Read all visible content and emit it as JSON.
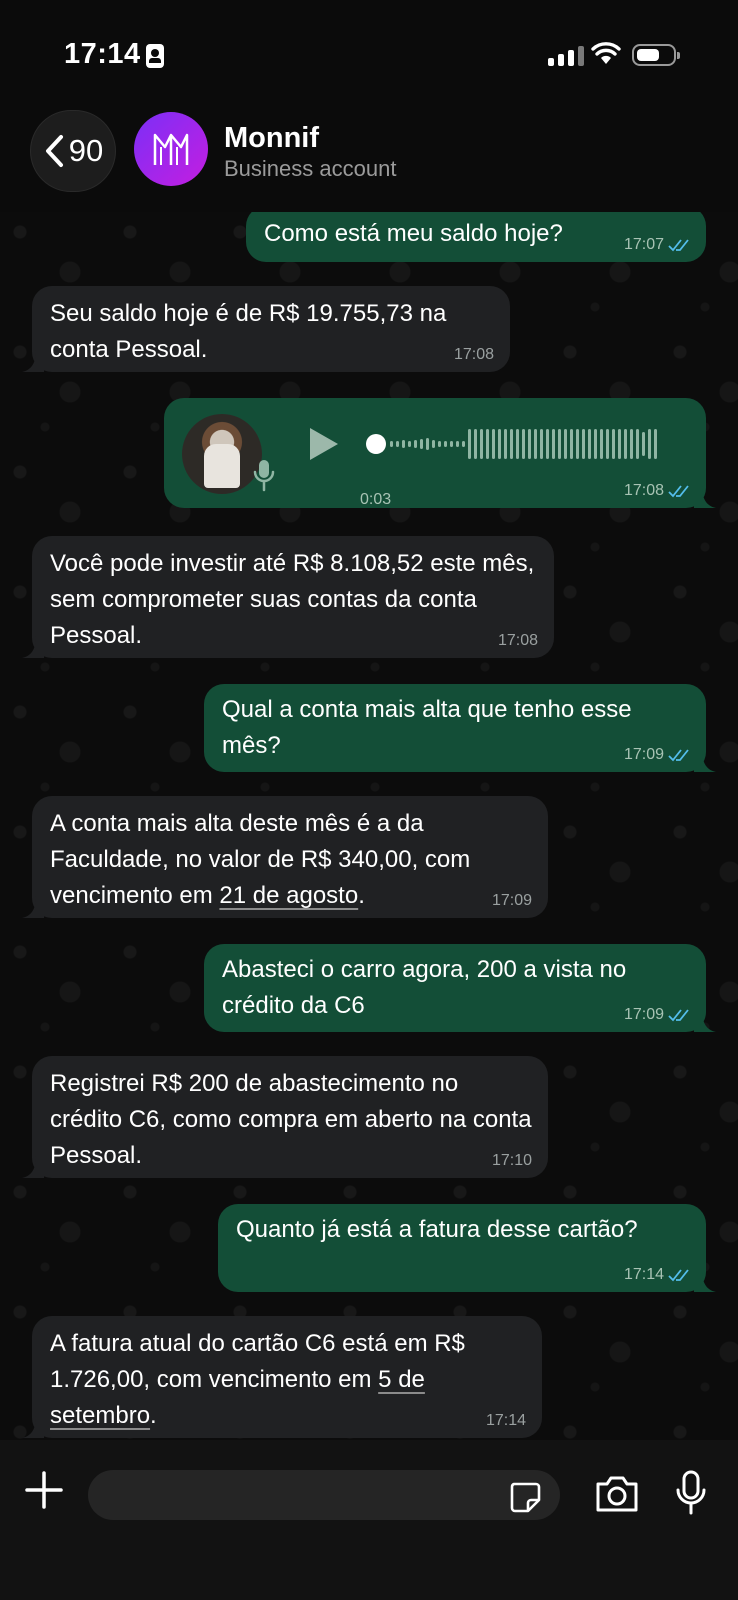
{
  "status_bar": {
    "time": "17:14"
  },
  "header": {
    "back_count": "90",
    "contact_name": "Monnif",
    "contact_subtitle": "Business account"
  },
  "messages": [
    {
      "dir": "out",
      "text": "Como está meu saldo hoje?",
      "time": "17:07",
      "read": true
    },
    {
      "dir": "in",
      "text": "Seu saldo hoje é de R$ 19.755,73 na conta Pessoal.",
      "time": "17:08"
    },
    {
      "dir": "out",
      "type": "voice",
      "duration": "0:03",
      "time": "17:08",
      "read": true
    },
    {
      "dir": "in",
      "text": "Você pode investir até R$ 8.108,52 este mês, sem comprometer suas contas da conta Pessoal.",
      "time": "17:08"
    },
    {
      "dir": "out",
      "text": "Qual a conta mais alta que tenho esse mês?",
      "time": "17:09",
      "read": true
    },
    {
      "dir": "in",
      "text_before": "A conta mais alta deste mês é a da Faculdade, no valor de R$ 340,00, com vencimento em ",
      "link": "21 de agosto",
      "text_after": ".",
      "time": "17:09"
    },
    {
      "dir": "out",
      "text": "Abasteci o carro agora, 200 a vista no crédito da C6",
      "time": "17:09",
      "read": true
    },
    {
      "dir": "in",
      "text": "Registrei R$ 200 de abastecimento no crédito C6, como compra em aberto na conta Pessoal.",
      "time": "17:10"
    },
    {
      "dir": "out",
      "text": "Quanto já está a fatura desse cartão?",
      "time": "17:14",
      "read": true
    },
    {
      "dir": "in",
      "text_before": "A fatura atual do cartão C6 está em R$ 1.726,00, com vencimento em ",
      "link": "5 de setembro",
      "text_after": ".",
      "time": "17:14"
    }
  ],
  "colors": {
    "incoming": "#202123",
    "outgoing": "#134e37",
    "read_tick": "#53bdeb",
    "avatar_gradient": [
      "#7b2ff7",
      "#c41ee0"
    ]
  },
  "icons": [
    "back-chevron-icon",
    "monnif-logo-icon",
    "play-icon",
    "mic-icon",
    "double-check-icon",
    "plus-icon",
    "sticker-icon",
    "camera-icon",
    "microphone-icon"
  ]
}
